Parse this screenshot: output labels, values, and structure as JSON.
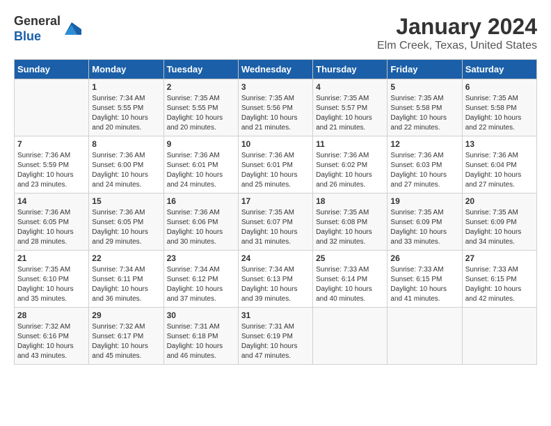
{
  "logo": {
    "general": "General",
    "blue": "Blue"
  },
  "header": {
    "title": "January 2024",
    "subtitle": "Elm Creek, Texas, United States"
  },
  "days_of_week": [
    "Sunday",
    "Monday",
    "Tuesday",
    "Wednesday",
    "Thursday",
    "Friday",
    "Saturday"
  ],
  "weeks": [
    [
      {
        "day": "",
        "sunrise": "",
        "sunset": "",
        "daylight": ""
      },
      {
        "day": "1",
        "sunrise": "Sunrise: 7:34 AM",
        "sunset": "Sunset: 5:55 PM",
        "daylight": "Daylight: 10 hours and 20 minutes."
      },
      {
        "day": "2",
        "sunrise": "Sunrise: 7:35 AM",
        "sunset": "Sunset: 5:55 PM",
        "daylight": "Daylight: 10 hours and 20 minutes."
      },
      {
        "day": "3",
        "sunrise": "Sunrise: 7:35 AM",
        "sunset": "Sunset: 5:56 PM",
        "daylight": "Daylight: 10 hours and 21 minutes."
      },
      {
        "day": "4",
        "sunrise": "Sunrise: 7:35 AM",
        "sunset": "Sunset: 5:57 PM",
        "daylight": "Daylight: 10 hours and 21 minutes."
      },
      {
        "day": "5",
        "sunrise": "Sunrise: 7:35 AM",
        "sunset": "Sunset: 5:58 PM",
        "daylight": "Daylight: 10 hours and 22 minutes."
      },
      {
        "day": "6",
        "sunrise": "Sunrise: 7:35 AM",
        "sunset": "Sunset: 5:58 PM",
        "daylight": "Daylight: 10 hours and 22 minutes."
      }
    ],
    [
      {
        "day": "7",
        "sunrise": "Sunrise: 7:36 AM",
        "sunset": "Sunset: 5:59 PM",
        "daylight": "Daylight: 10 hours and 23 minutes."
      },
      {
        "day": "8",
        "sunrise": "Sunrise: 7:36 AM",
        "sunset": "Sunset: 6:00 PM",
        "daylight": "Daylight: 10 hours and 24 minutes."
      },
      {
        "day": "9",
        "sunrise": "Sunrise: 7:36 AM",
        "sunset": "Sunset: 6:01 PM",
        "daylight": "Daylight: 10 hours and 24 minutes."
      },
      {
        "day": "10",
        "sunrise": "Sunrise: 7:36 AM",
        "sunset": "Sunset: 6:01 PM",
        "daylight": "Daylight: 10 hours and 25 minutes."
      },
      {
        "day": "11",
        "sunrise": "Sunrise: 7:36 AM",
        "sunset": "Sunset: 6:02 PM",
        "daylight": "Daylight: 10 hours and 26 minutes."
      },
      {
        "day": "12",
        "sunrise": "Sunrise: 7:36 AM",
        "sunset": "Sunset: 6:03 PM",
        "daylight": "Daylight: 10 hours and 27 minutes."
      },
      {
        "day": "13",
        "sunrise": "Sunrise: 7:36 AM",
        "sunset": "Sunset: 6:04 PM",
        "daylight": "Daylight: 10 hours and 27 minutes."
      }
    ],
    [
      {
        "day": "14",
        "sunrise": "Sunrise: 7:36 AM",
        "sunset": "Sunset: 6:05 PM",
        "daylight": "Daylight: 10 hours and 28 minutes."
      },
      {
        "day": "15",
        "sunrise": "Sunrise: 7:36 AM",
        "sunset": "Sunset: 6:05 PM",
        "daylight": "Daylight: 10 hours and 29 minutes."
      },
      {
        "day": "16",
        "sunrise": "Sunrise: 7:36 AM",
        "sunset": "Sunset: 6:06 PM",
        "daylight": "Daylight: 10 hours and 30 minutes."
      },
      {
        "day": "17",
        "sunrise": "Sunrise: 7:35 AM",
        "sunset": "Sunset: 6:07 PM",
        "daylight": "Daylight: 10 hours and 31 minutes."
      },
      {
        "day": "18",
        "sunrise": "Sunrise: 7:35 AM",
        "sunset": "Sunset: 6:08 PM",
        "daylight": "Daylight: 10 hours and 32 minutes."
      },
      {
        "day": "19",
        "sunrise": "Sunrise: 7:35 AM",
        "sunset": "Sunset: 6:09 PM",
        "daylight": "Daylight: 10 hours and 33 minutes."
      },
      {
        "day": "20",
        "sunrise": "Sunrise: 7:35 AM",
        "sunset": "Sunset: 6:09 PM",
        "daylight": "Daylight: 10 hours and 34 minutes."
      }
    ],
    [
      {
        "day": "21",
        "sunrise": "Sunrise: 7:35 AM",
        "sunset": "Sunset: 6:10 PM",
        "daylight": "Daylight: 10 hours and 35 minutes."
      },
      {
        "day": "22",
        "sunrise": "Sunrise: 7:34 AM",
        "sunset": "Sunset: 6:11 PM",
        "daylight": "Daylight: 10 hours and 36 minutes."
      },
      {
        "day": "23",
        "sunrise": "Sunrise: 7:34 AM",
        "sunset": "Sunset: 6:12 PM",
        "daylight": "Daylight: 10 hours and 37 minutes."
      },
      {
        "day": "24",
        "sunrise": "Sunrise: 7:34 AM",
        "sunset": "Sunset: 6:13 PM",
        "daylight": "Daylight: 10 hours and 39 minutes."
      },
      {
        "day": "25",
        "sunrise": "Sunrise: 7:33 AM",
        "sunset": "Sunset: 6:14 PM",
        "daylight": "Daylight: 10 hours and 40 minutes."
      },
      {
        "day": "26",
        "sunrise": "Sunrise: 7:33 AM",
        "sunset": "Sunset: 6:15 PM",
        "daylight": "Daylight: 10 hours and 41 minutes."
      },
      {
        "day": "27",
        "sunrise": "Sunrise: 7:33 AM",
        "sunset": "Sunset: 6:15 PM",
        "daylight": "Daylight: 10 hours and 42 minutes."
      }
    ],
    [
      {
        "day": "28",
        "sunrise": "Sunrise: 7:32 AM",
        "sunset": "Sunset: 6:16 PM",
        "daylight": "Daylight: 10 hours and 43 minutes."
      },
      {
        "day": "29",
        "sunrise": "Sunrise: 7:32 AM",
        "sunset": "Sunset: 6:17 PM",
        "daylight": "Daylight: 10 hours and 45 minutes."
      },
      {
        "day": "30",
        "sunrise": "Sunrise: 7:31 AM",
        "sunset": "Sunset: 6:18 PM",
        "daylight": "Daylight: 10 hours and 46 minutes."
      },
      {
        "day": "31",
        "sunrise": "Sunrise: 7:31 AM",
        "sunset": "Sunset: 6:19 PM",
        "daylight": "Daylight: 10 hours and 47 minutes."
      },
      {
        "day": "",
        "sunrise": "",
        "sunset": "",
        "daylight": ""
      },
      {
        "day": "",
        "sunrise": "",
        "sunset": "",
        "daylight": ""
      },
      {
        "day": "",
        "sunrise": "",
        "sunset": "",
        "daylight": ""
      }
    ]
  ]
}
